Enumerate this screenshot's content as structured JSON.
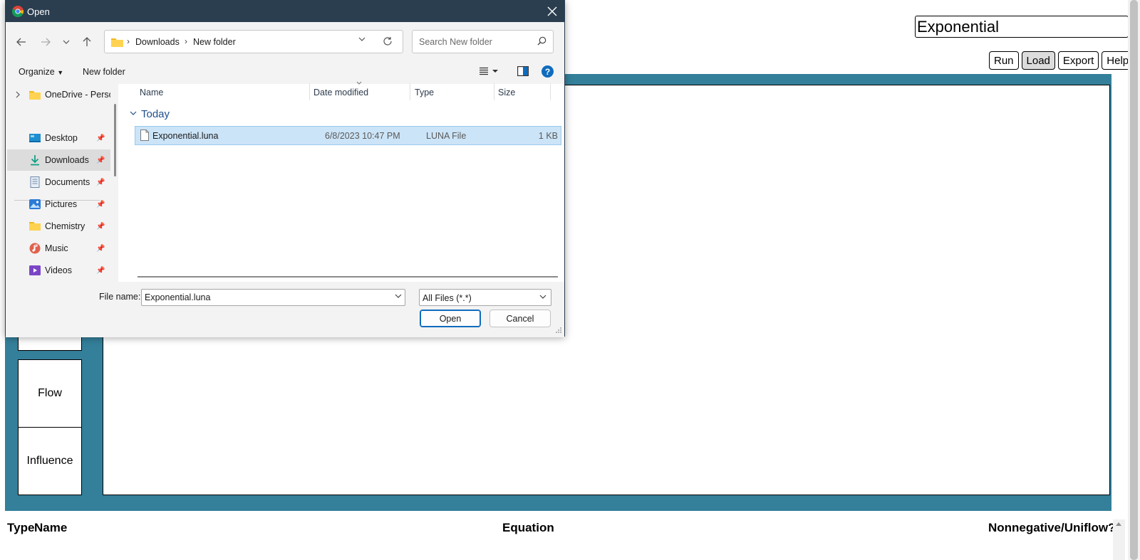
{
  "app": {
    "model_name": "Exponential",
    "toolbar": [
      "Run",
      "Load",
      "Export",
      "Help"
    ],
    "palette": [
      "Flow",
      "Influence"
    ],
    "table_headers": {
      "type": "Type",
      "name": "Name",
      "equation": "Equation",
      "nonnegative": "Nonnegative/Uniflow?"
    },
    "colors": {
      "work_area": "#347f9a",
      "dialog_titlebar": "#2b3e50",
      "selection": "#cce4f7"
    }
  },
  "dialog": {
    "title": "Open",
    "title_icon": "chrome-icon",
    "breadcrumb": [
      "Downloads",
      "New folder"
    ],
    "search_placeholder": "Search New folder",
    "commands": {
      "organize": "Organize",
      "new_folder": "New folder"
    },
    "nav_items": [
      {
        "label": "OneDrive - Perso",
        "icon": "onedrive-folder-icon",
        "pinned": false,
        "selected": false
      },
      {
        "label": "Desktop",
        "icon": "desktop-icon",
        "pinned": true,
        "selected": false
      },
      {
        "label": "Downloads",
        "icon": "download-icon",
        "pinned": true,
        "selected": true
      },
      {
        "label": "Documents",
        "icon": "documents-icon",
        "pinned": true,
        "selected": false
      },
      {
        "label": "Pictures",
        "icon": "pictures-icon",
        "pinned": true,
        "selected": false
      },
      {
        "label": "Chemistry",
        "icon": "folder-icon",
        "pinned": true,
        "selected": false
      },
      {
        "label": "Music",
        "icon": "music-icon",
        "pinned": true,
        "selected": false
      },
      {
        "label": "Videos",
        "icon": "videos-icon",
        "pinned": true,
        "selected": false
      }
    ],
    "columns": {
      "name": "Name",
      "date": "Date modified",
      "type": "Type",
      "size": "Size"
    },
    "group": "Today",
    "files": [
      {
        "name": "Exponential.luna",
        "date": "6/8/2023 10:47 PM",
        "type": "LUNA File",
        "size": "1 KB",
        "selected": true
      }
    ],
    "file_name_label": "File name:",
    "file_name_value": "Exponential.luna",
    "file_type_filter": "All Files (*.*)",
    "open_button": "Open",
    "cancel_button": "Cancel"
  }
}
